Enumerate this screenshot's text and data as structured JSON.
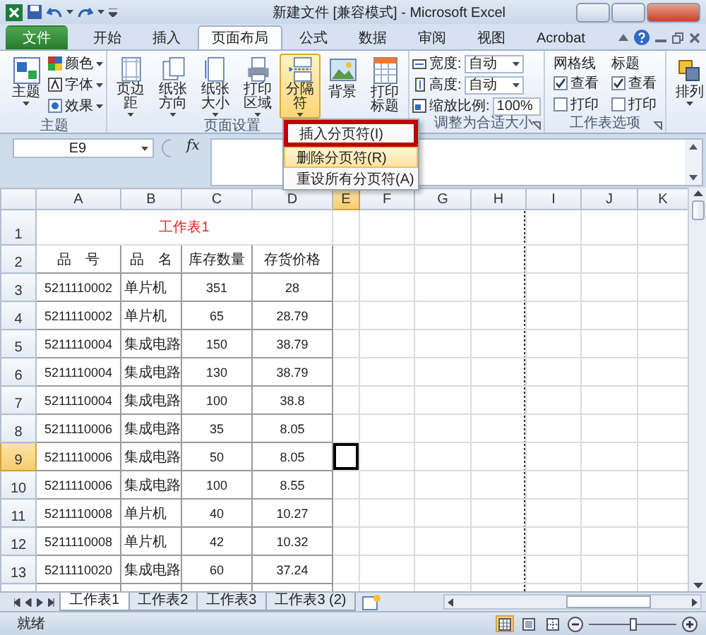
{
  "window": {
    "title": "新建文件 [兼容模式] - Microsoft Excel"
  },
  "tabs": [
    {
      "label": "文件",
      "kind": "file",
      "selected": false
    },
    {
      "label": "开始",
      "kind": "tab",
      "selected": false
    },
    {
      "label": "插入",
      "kind": "tab",
      "selected": false
    },
    {
      "label": "页面布局",
      "kind": "tab",
      "selected": true
    },
    {
      "label": "公式",
      "kind": "tab",
      "selected": false
    },
    {
      "label": "数据",
      "kind": "tab",
      "selected": false
    },
    {
      "label": "审阅",
      "kind": "tab",
      "selected": false
    },
    {
      "label": "视图",
      "kind": "tab",
      "selected": false
    },
    {
      "label": "Acrobat",
      "kind": "tab",
      "selected": false
    }
  ],
  "ribbon": {
    "groups": [
      {
        "label": "主题",
        "launcher": false,
        "items": [
          {
            "kind": "large",
            "label": "主题",
            "dropdown": true,
            "expanded": false
          },
          {
            "kind": "small",
            "label": "颜色",
            "dropdown": true
          },
          {
            "kind": "small",
            "label": "字体",
            "dropdown": true
          },
          {
            "kind": "small",
            "label": "效果",
            "dropdown": true
          }
        ]
      },
      {
        "label": "页面设置",
        "launcher": false,
        "items": [
          {
            "kind": "large",
            "label": "页边距",
            "dropdown": true,
            "expanded": false
          },
          {
            "kind": "large",
            "label": "纸张方向",
            "dropdown": true,
            "expanded": false
          },
          {
            "kind": "large",
            "label": "纸张大小",
            "dropdown": true,
            "expanded": false
          },
          {
            "kind": "large",
            "label": "打印区域",
            "dropdown": true,
            "expanded": false
          },
          {
            "kind": "large",
            "label": "分隔符",
            "dropdown": true,
            "expanded": true
          },
          {
            "kind": "large",
            "label": "背景",
            "dropdown": false,
            "expanded": false
          },
          {
            "kind": "large",
            "label": "打印标题",
            "dropdown": false,
            "expanded": false
          }
        ]
      },
      {
        "label": "调整为合适大小",
        "launcher": true,
        "items": [
          {
            "kind": "field",
            "label": "宽度:",
            "value": "自动"
          },
          {
            "kind": "field",
            "label": "高度:",
            "value": "自动"
          },
          {
            "kind": "spin",
            "label": "缩放比例:",
            "value": "100%"
          }
        ]
      },
      {
        "label": "工作表选项",
        "launcher": true,
        "items": [
          {
            "kind": "options",
            "label": "网格线",
            "options": [
              {
                "label": "查看",
                "checked": true
              },
              {
                "label": "打印",
                "checked": false
              }
            ]
          },
          {
            "kind": "options",
            "label": "标题",
            "options": [
              {
                "label": "查看",
                "checked": true
              },
              {
                "label": "打印",
                "checked": false
              }
            ]
          }
        ]
      },
      {
        "launcher": false,
        "items": [
          {
            "kind": "large",
            "label": "排列",
            "dropdown": true,
            "expanded": false
          }
        ]
      }
    ]
  },
  "menu": {
    "items": [
      {
        "label": "插入分页符(I)",
        "selected": false,
        "marked": true
      },
      {
        "label": "删除分页符(R)",
        "selected": true,
        "marked": false
      },
      {
        "label": "重设所有分页符(A)",
        "selected": false,
        "marked": false
      }
    ]
  },
  "formula_bar": {
    "name_box": "E9",
    "function_label": "fx"
  },
  "sheet": {
    "columns": [
      {
        "label": "A",
        "selected": false,
        "page_break": false
      },
      {
        "label": "B",
        "selected": false,
        "page_break": false
      },
      {
        "label": "C",
        "selected": false,
        "page_break": false
      },
      {
        "label": "D",
        "selected": false,
        "page_break": false
      },
      {
        "label": "E",
        "selected": true,
        "page_break": false
      },
      {
        "label": "F",
        "selected": false,
        "page_break": false
      },
      {
        "label": "G",
        "selected": false,
        "page_break": false
      },
      {
        "label": "H",
        "selected": false,
        "page_break": true
      },
      {
        "label": "I",
        "selected": false,
        "page_break": false
      },
      {
        "label": "J",
        "selected": false,
        "page_break": false
      },
      {
        "label": "K",
        "selected": false,
        "page_break": false
      }
    ],
    "rows": [
      {
        "header": "1",
        "kind": "title",
        "selected": false,
        "text": "工作表1"
      },
      {
        "header": "2",
        "kind": "header",
        "selected": false,
        "cells": [
          "品　号",
          "品　名",
          "库存数量",
          "存货价格"
        ]
      },
      {
        "header": "3",
        "kind": "data",
        "selected": false,
        "cells": [
          "5211110002",
          "单片机",
          "351",
          "28"
        ]
      },
      {
        "header": "4",
        "kind": "data",
        "selected": false,
        "cells": [
          "5211110002",
          "单片机",
          "65",
          "28.79"
        ]
      },
      {
        "header": "5",
        "kind": "data",
        "selected": false,
        "cells": [
          "5211110004",
          "集成电路",
          "150",
          "38.79"
        ]
      },
      {
        "header": "6",
        "kind": "data",
        "selected": false,
        "cells": [
          "5211110004",
          "集成电路",
          "130",
          "38.79"
        ]
      },
      {
        "header": "7",
        "kind": "data",
        "selected": false,
        "cells": [
          "5211110004",
          "集成电路",
          "100",
          "38.8"
        ]
      },
      {
        "header": "8",
        "kind": "data",
        "selected": false,
        "cells": [
          "5211110006",
          "集成电路",
          "35",
          "8.05"
        ]
      },
      {
        "header": "9",
        "kind": "data",
        "selected": true,
        "cells": [
          "5211110006",
          "集成电路",
          "50",
          "8.05"
        ]
      },
      {
        "header": "10",
        "kind": "data",
        "selected": false,
        "cells": [
          "5211110006",
          "集成电路",
          "100",
          "8.55"
        ]
      },
      {
        "header": "11",
        "kind": "data",
        "selected": false,
        "cells": [
          "5211110008",
          "单片机",
          "40",
          "10.27"
        ]
      },
      {
        "header": "12",
        "kind": "data",
        "selected": false,
        "cells": [
          "5211110008",
          "单片机",
          "42",
          "10.32"
        ]
      },
      {
        "header": "13",
        "kind": "data",
        "selected": false,
        "cells": [
          "5211110020",
          "集成电路",
          "60",
          "37.24"
        ]
      },
      {
        "kind": "blank",
        "selected": false
      }
    ]
  },
  "sheet_tabs": [
    {
      "label": "工作表1",
      "selected": true
    },
    {
      "label": "工作表2",
      "selected": false
    },
    {
      "label": "工作表3",
      "selected": false
    },
    {
      "label": "工作表3 (2)",
      "selected": false
    }
  ],
  "status_bar": {
    "text": "就绪",
    "views": [
      {
        "selected": true
      },
      {
        "selected": false
      },
      {
        "selected": false
      }
    ],
    "zoom": {
      "level": 0.5
    }
  }
}
